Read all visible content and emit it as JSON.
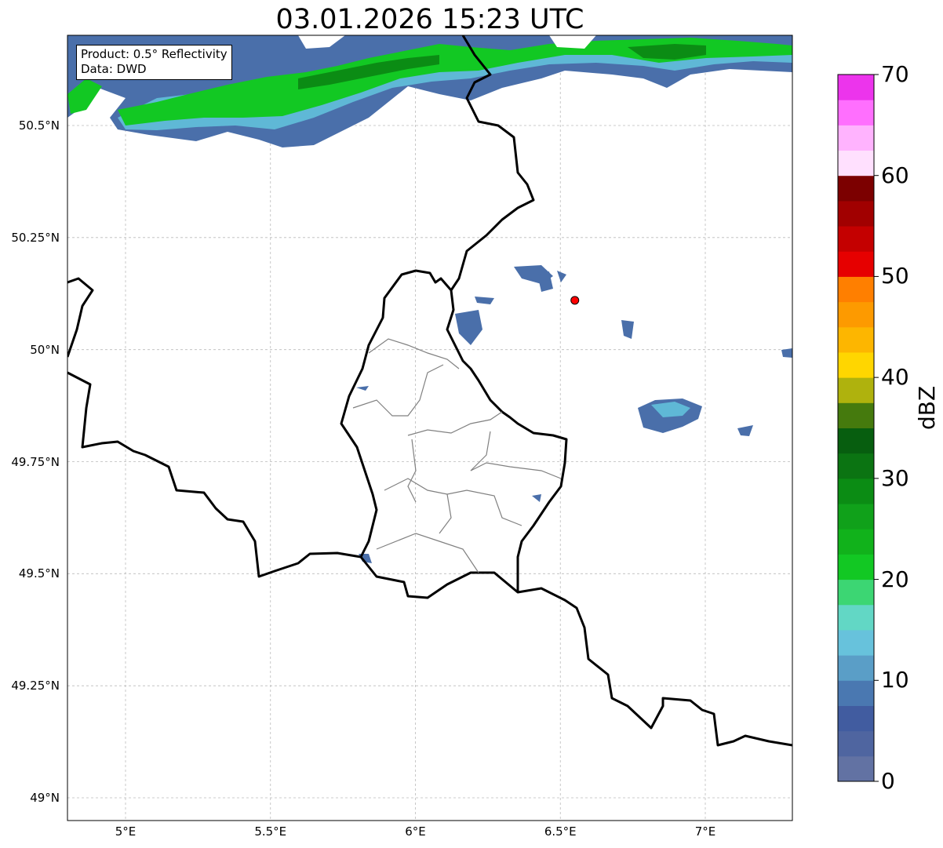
{
  "title": "03.01.2026 15:23 UTC",
  "info_box": {
    "product": "Product: 0.5° Reflectivity",
    "source": "Data: DWD"
  },
  "map": {
    "lon_range": [
      4.8,
      7.3
    ],
    "lat_range": [
      48.95,
      50.7
    ],
    "lat_ticks": [
      "50.5°N",
      "50.25°N",
      "50°N",
      "49.75°N",
      "49.5°N",
      "49.25°N",
      "49°N"
    ],
    "lon_ticks": [
      "5°E",
      "5.5°E",
      "6°E",
      "6.5°E",
      "7°E"
    ],
    "gridlines": true,
    "marker": {
      "lon": 6.55,
      "lat": 50.11,
      "color": "#ff0000"
    },
    "land_color": "#ffffff",
    "border_color": "#000000",
    "district_color": "#808080"
  },
  "colorbar": {
    "unit": "dBZ",
    "min": 0,
    "max": 70,
    "tick_labels": [
      "0",
      "10",
      "20",
      "30",
      "40",
      "50",
      "60",
      "70"
    ],
    "colors": [
      "#6272a3",
      "#4f65a0",
      "#415ca0",
      "#4a78b1",
      "#5a9ec7",
      "#67c2dc",
      "#62d7c5",
      "#3cd673",
      "#12c823",
      "#11b21b",
      "#10a11a",
      "#0b8c14",
      "#0b7412",
      "#075e0f",
      "#457a0d",
      "#afb20d",
      "#ffd600",
      "#fdb600",
      "#fd9a00",
      "#ff7f00",
      "#e60000",
      "#c40000",
      "#a10000",
      "#7c0000",
      "#ffe0fe",
      "#ffb3fe",
      "#ff6ffe",
      "#ec34ec"
    ]
  }
}
